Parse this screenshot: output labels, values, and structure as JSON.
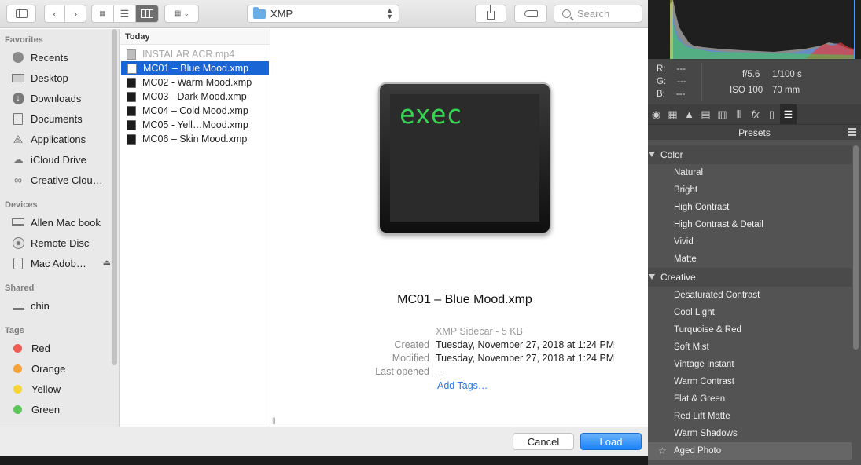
{
  "dialog": {
    "toolbar": {
      "path": "XMP",
      "search_placeholder": "Search"
    },
    "sidebar": {
      "favorites_header": "Favorites",
      "favorites": [
        {
          "label": "Recents",
          "icon": "clock-icon"
        },
        {
          "label": "Desktop",
          "icon": "desktop-icon"
        },
        {
          "label": "Downloads",
          "icon": "download-icon"
        },
        {
          "label": "Documents",
          "icon": "documents-icon"
        },
        {
          "label": "Applications",
          "icon": "applications-icon"
        },
        {
          "label": "iCloud Drive",
          "icon": "cloud-icon"
        },
        {
          "label": "Creative Clou…",
          "icon": "creative-cloud-icon"
        }
      ],
      "devices_header": "Devices",
      "devices": [
        {
          "label": "Allen Mac book",
          "icon": "laptop-icon"
        },
        {
          "label": "Remote Disc",
          "icon": "disc-icon"
        },
        {
          "label": "Mac Adob…",
          "icon": "drive-icon"
        }
      ],
      "shared_header": "Shared",
      "shared": [
        {
          "label": "chin",
          "icon": "computer-icon"
        }
      ],
      "tags_header": "Tags",
      "tags": [
        {
          "label": "Red",
          "color": "#f25b54"
        },
        {
          "label": "Orange",
          "color": "#f6a23b"
        },
        {
          "label": "Yellow",
          "color": "#f7d33a"
        },
        {
          "label": "Green",
          "color": "#5bc85a"
        }
      ]
    },
    "file_column": {
      "header": "Today",
      "files": [
        {
          "name": "INSTALAR ACR.mp4",
          "kind": "video",
          "state": "dim"
        },
        {
          "name": "MC01 – Blue Mood.xmp",
          "kind": "doc",
          "state": "selected"
        },
        {
          "name": "MC02 - Warm Mood.xmp",
          "kind": "term",
          "state": "normal"
        },
        {
          "name": "MC03 - Dark Mood.xmp",
          "kind": "term",
          "state": "normal"
        },
        {
          "name": "MC04 – Cold Mood.xmp",
          "kind": "term",
          "state": "normal"
        },
        {
          "name": "MC05 - Yell…Mood.xmp",
          "kind": "term",
          "state": "normal"
        },
        {
          "name": "MC06 – Skin Mood.xmp",
          "kind": "term",
          "state": "normal"
        }
      ]
    },
    "preview": {
      "icon_text": "exec",
      "file_name": "MC01 – Blue Mood.xmp",
      "kind_size": "XMP Sidecar - 5 KB",
      "created_label": "Created",
      "created_value": "Tuesday, November 27, 2018 at 1:24 PM",
      "modified_label": "Modified",
      "modified_value": "Tuesday, November 27, 2018 at 1:24 PM",
      "last_opened_label": "Last opened",
      "last_opened_value": "--",
      "add_tags": "Add Tags…"
    },
    "footer": {
      "cancel_label": "Cancel",
      "load_label": "Load"
    }
  },
  "camera_raw": {
    "readout": {
      "r_label": "R:",
      "r_value": "---",
      "g_label": "G:",
      "g_value": "---",
      "b_label": "B:",
      "b_value": "---",
      "aperture": "f/5.6",
      "shutter": "1/100 s",
      "iso": "ISO 100",
      "focal": "70 mm"
    },
    "presets_title": "Presets",
    "groups": [
      {
        "name": "Color",
        "items": [
          "Natural",
          "Bright",
          "High Contrast",
          "High Contrast & Detail",
          "Vivid",
          "Matte"
        ]
      },
      {
        "name": "Creative",
        "items": [
          "Desaturated Contrast",
          "Cool Light",
          "Turquoise & Red",
          "Soft Mist",
          "Vintage Instant",
          "Warm Contrast",
          "Flat & Green",
          "Red Lift Matte",
          "Warm Shadows",
          "Aged Photo"
        ]
      }
    ]
  }
}
